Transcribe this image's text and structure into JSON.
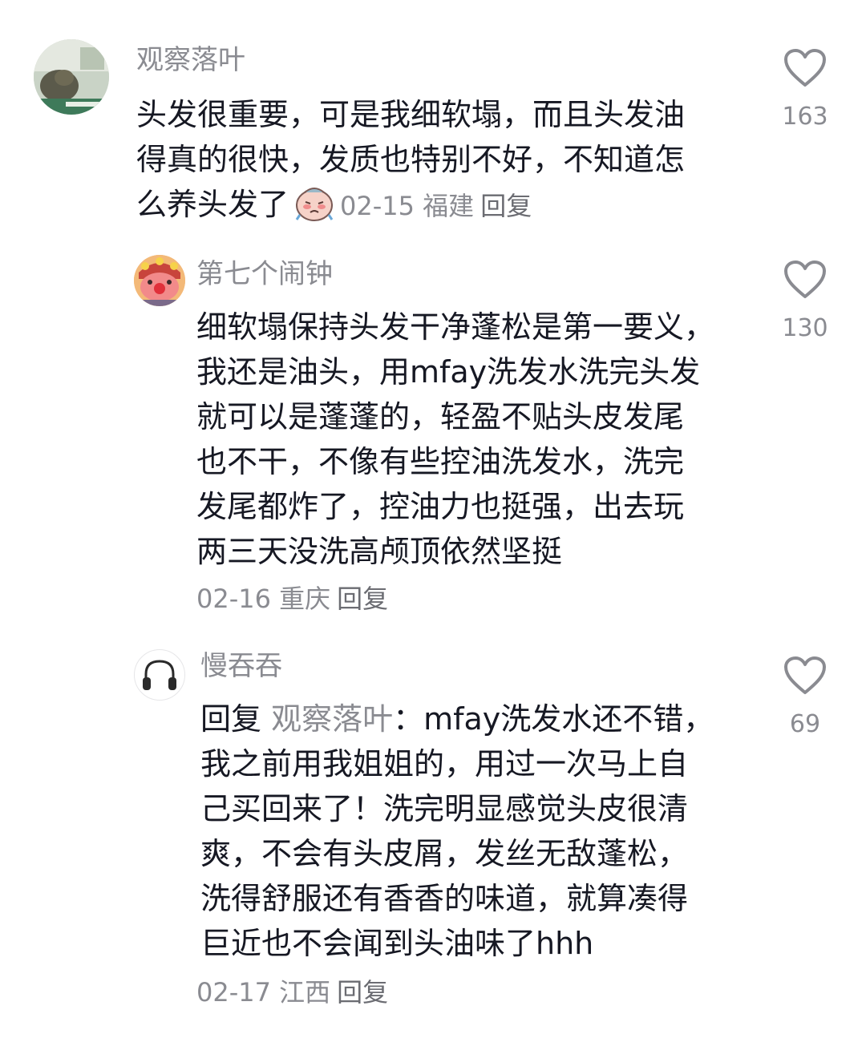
{
  "comments": [
    {
      "username": "观察落叶",
      "avatar": "photo-avatar",
      "lines": [
        "头发很重要，可是我细软塌，而且头发油",
        "得真的很快，发质也特别不好，不知道怎",
        "么养头发了"
      ],
      "emoji": "crying-face-emoji",
      "date": "02-15",
      "location": "福建",
      "reply_label": "回复",
      "likes": "163"
    },
    {
      "username": "第七个闹钟",
      "avatar": "cartoon-avatar",
      "lines": [
        "细软塌保持头发干净蓬松是第一要义，",
        "我还是油头，用mfay洗发水洗完头发",
        "就可以是蓬蓬的，轻盈不贴头皮发尾",
        "也不干，不像有些控油洗发水，洗完",
        "发尾都炸了，控油力也挺强，出去玩",
        "两三天没洗高颅顶依然坚挺"
      ],
      "date": "02-16",
      "location": "重庆",
      "reply_label": "回复",
      "likes": "130"
    },
    {
      "username": "慢吞吞",
      "avatar": "headphones-avatar",
      "reply_prefix": "回复",
      "reply_target": "观察落叶",
      "first_line_rest": "：mfay洗发水还不错，",
      "lines": [
        "我之前用我姐姐的，用过一次马上自",
        "己买回来了！洗完明显感觉头皮很清",
        "爽，不会有头皮屑，发丝无敌蓬松，",
        "洗得舒服还有香香的味道，就算凑得",
        "巨近也不会闻到头油味了hhh"
      ],
      "date": "02-17",
      "location": "江西",
      "reply_label": "回复",
      "likes": "69"
    }
  ],
  "colors": {
    "text": "#161823",
    "secondary": "#8a8b91",
    "background": "#ffffff"
  }
}
